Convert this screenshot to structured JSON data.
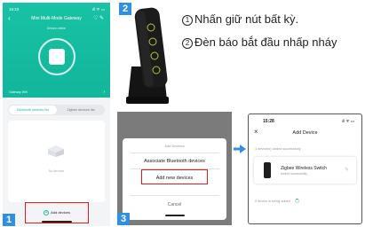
{
  "colors": {
    "accent": "#19b89c",
    "highlight": "#e21c1c",
    "step_badge": "#2f8fe3",
    "overlay": "#7b7b7b"
  },
  "steps": [
    "1",
    "2",
    "3"
  ],
  "panel1": {
    "status_time": "15:23",
    "status_icons": "ıll ᯤ ▭",
    "back_icon": "chevron-left-icon",
    "title": "Mini Multi-Mode Gateway",
    "header_icons": "♡ ✎",
    "subtitle": "Device online",
    "gateway_bar": "Gateway Wifi",
    "tabs": [
      "Bluetooth devices list",
      "Zigbee devices list"
    ],
    "empty_text": "No devices",
    "add_devices": "Add devices"
  },
  "instructions": {
    "step1_num": "1",
    "step1": "Nhấn giữ nút bất kỳ.",
    "step2_num": "2",
    "step2": "Đèn báo bắt đầu nhấp nháy"
  },
  "panel3": {
    "sheet_title": "Add Devices",
    "option1": "Associate Bluetooth devices",
    "option2": "Add new devices",
    "cancel": "Cancel"
  },
  "panel4": {
    "status_time": "15:28",
    "status_icons": "ıll ᯤ ▭",
    "close_icon": "close-icon",
    "title": "Add Device",
    "added_note": "1 device(s) added successfully",
    "device_name": "Zigbee Wireless Switch",
    "device_status": "Added successfully",
    "adding_note": "0 device is being added"
  }
}
